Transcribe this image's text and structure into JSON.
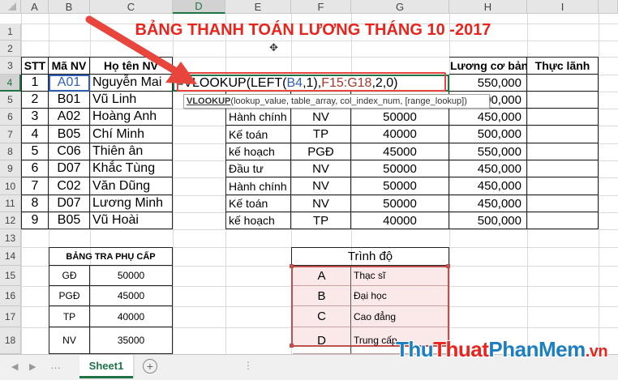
{
  "columns": [
    "A",
    "B",
    "C",
    "D",
    "E",
    "F",
    "G",
    "H",
    "I"
  ],
  "rows": [
    "1",
    "2",
    "3",
    "4",
    "5",
    "6",
    "7",
    "8",
    "9",
    "10",
    "11",
    "12",
    "13",
    "14",
    "15",
    "16",
    "17",
    "18"
  ],
  "title": "BẢNG THANH TOÁN LƯƠNG THÁNG 10 -2017",
  "headers": {
    "stt": "STT",
    "ma_nv": "Mã NV",
    "ho_ten": "Họ tên NV",
    "luong": "Lương cơ bản",
    "thuc_lanh": "Thực lãnh"
  },
  "employees": [
    {
      "stt": "1",
      "ma": "A01",
      "ten": "Nguyễn Mai",
      "phong": "",
      "chuc": "",
      "phucap": "",
      "luong": "550,000"
    },
    {
      "stt": "2",
      "ma": "B01",
      "ten": "Vũ Linh",
      "phong": "",
      "chuc": "",
      "phucap": "",
      "luong": "500,000"
    },
    {
      "stt": "3",
      "ma": "A02",
      "ten": "Hoàng Anh",
      "phong": "Hành chính",
      "chuc": "NV",
      "phucap": "50000",
      "luong": "450,000"
    },
    {
      "stt": "4",
      "ma": "B05",
      "ten": "Chí Minh",
      "phong": "Kế toán",
      "chuc": "TP",
      "phucap": "40000",
      "luong": "500,000"
    },
    {
      "stt": "5",
      "ma": "C06",
      "ten": "Thiên ân",
      "phong": "kế hoạch",
      "chuc": "PGĐ",
      "phucap": "45000",
      "luong": "550,000"
    },
    {
      "stt": "6",
      "ma": "D07",
      "ten": "Khắc Tùng",
      "phong": "Đầu tư",
      "chuc": "NV",
      "phucap": "50000",
      "luong": "450,000"
    },
    {
      "stt": "7",
      "ma": "C02",
      "ten": "Văn Dũng",
      "phong": "Hành chính",
      "chuc": "NV",
      "phucap": "50000",
      "luong": "450,000"
    },
    {
      "stt": "8",
      "ma": "D07",
      "ten": "Lương Minh",
      "phong": "Kế toán",
      "chuc": "NV",
      "phucap": "50000",
      "luong": "450,000"
    },
    {
      "stt": "9",
      "ma": "B05",
      "ten": "Vũ Hoài",
      "phong": "kế hoạch",
      "chuc": "TP",
      "phucap": "40000",
      "luong": "500,000"
    }
  ],
  "formula": {
    "p1": "=VLOOKUP(LEFT(",
    "ref1": "B4",
    "p2": ",1),",
    "ref2": "F15:G18",
    "p3": ",2,0)"
  },
  "tooltip": {
    "fn": "VLOOKUP",
    "args": "(lookup_value, table_array, col_index_num, [range_lookup])"
  },
  "phucap_table": {
    "title": "BẢNG TRA PHỤ CẤP",
    "rows": [
      {
        "k": "GĐ",
        "v": "50000"
      },
      {
        "k": "PGĐ",
        "v": "45000"
      },
      {
        "k": "TP",
        "v": "40000"
      },
      {
        "k": "NV",
        "v": "35000"
      }
    ]
  },
  "trinhdo_table": {
    "title": "Trình độ",
    "rows": [
      {
        "k": "A",
        "v": "Thạc sĩ"
      },
      {
        "k": "B",
        "v": "Đại học"
      },
      {
        "k": "C",
        "v": "Cao đẳng"
      },
      {
        "k": "D",
        "v": "Trung cấp"
      }
    ]
  },
  "sheet_tab": "Sheet1",
  "add_sheet": "+",
  "watermark": {
    "a": "Thu",
    "b": "Thuat",
    "c": "PhanMem",
    ".vn": ".vn"
  },
  "colors": {
    "arrow": "#e8453c",
    "title": "#e8241c",
    "ref1": "#2f5fb3",
    "ref2": "#a8342c",
    "trinhdo_fill": "#fbe9e9",
    "trinhdo_border": "#c0504d",
    "excel_green": "#217346"
  }
}
